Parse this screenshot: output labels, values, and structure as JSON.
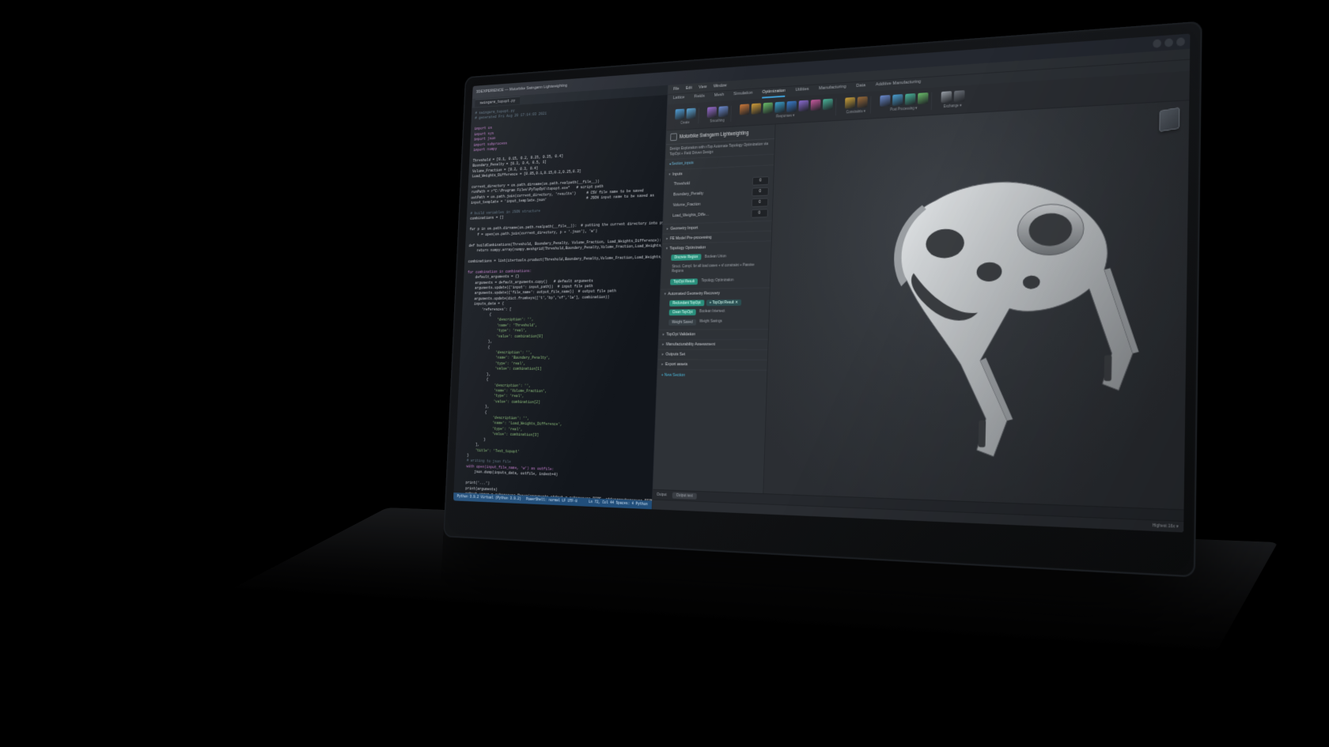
{
  "window_title": "3DEXPERIENCE — Motorbike Swingarm Lightweighting",
  "editor": {
    "tab": "swingarm_topopt.py",
    "status": {
      "left": "Python 3.9.2   Virtual (Python 3.9.2)",
      "mid": "PowerShell: normal  LF  UTF-8",
      "right": "Ln 72, Col 44   Spaces: 4   Python"
    },
    "code_lines": [
      {
        "cls": "cm",
        "t": "# swingarm_topopt.py"
      },
      {
        "cls": "cm",
        "t": "# generated Fri Aug 20 17:14:03 2021"
      },
      {
        "cls": "",
        "t": ""
      },
      {
        "cls": "kw",
        "t": "import os"
      },
      {
        "cls": "kw",
        "t": "import sys"
      },
      {
        "cls": "kw",
        "t": "import json"
      },
      {
        "cls": "kw",
        "t": "import subprocess"
      },
      {
        "cls": "kw",
        "t": "import numpy"
      },
      {
        "cls": "",
        "t": ""
      },
      {
        "cls": "nm",
        "t": "Threshold = [0.1, 0.15, 0.2, 0.25, 0.35, 0.4]"
      },
      {
        "cls": "nm",
        "t": "Boundary_Penalty = [0.3, 0.4, 0.5, 1]"
      },
      {
        "cls": "nm",
        "t": "Volume_Fraction = [0.2, 0.3, 0.4]"
      },
      {
        "cls": "nm",
        "t": "Load_Weights_Difference = [0.05,0.1,0.15,0.2,0.25,0.3]"
      },
      {
        "cls": "",
        "t": ""
      },
      {
        "cls": "nm",
        "t": "current_directory = os.path.dirname(os.path.realpath(__file__))"
      },
      {
        "cls": "nm",
        "t": "runPath = r\"C:\\Program Files\\PyTopOpt\\topopt.exe\"   # script path"
      },
      {
        "cls": "nm",
        "t": "outPath = os.path.join(current_directory, 'results')     # CSV file name to be saved"
      },
      {
        "cls": "nm",
        "t": "input_template = 'input_template.json'                   # JSON input name to be saved as"
      },
      {
        "cls": "",
        "t": ""
      },
      {
        "cls": "cm",
        "t": "# build variables in JSON structure"
      },
      {
        "cls": "nm",
        "t": "combinations = []"
      },
      {
        "cls": "",
        "t": ""
      },
      {
        "cls": "nm",
        "t": "for p in os.path.dirname(os.path.realpath(__file__)):  # putting the current directory into python file so"
      },
      {
        "cls": "nm",
        "t": "    f = open(os.path.join(current_directory, p + '.json'), 'w')"
      },
      {
        "cls": "",
        "t": ""
      },
      {
        "cls": "nm",
        "t": "def buildCombinations(Threshold, Boundary_Penalty, Volume_Fraction, Load_Weights_Difference):"
      },
      {
        "cls": "nm",
        "t": "    return numpy.array(numpy.meshgrid(Threshold,Boundary_Penalty,Volume_Fraction,Load_Weights_Difference))"
      },
      {
        "cls": "",
        "t": ""
      },
      {
        "cls": "nm",
        "t": "combinations = list(itertools.product(Threshold,Boundary_Penalty,Volume_Fraction,Load_Weights_Difference))"
      },
      {
        "cls": "",
        "t": ""
      },
      {
        "cls": "kw",
        "t": "for combination in combinations:"
      },
      {
        "cls": "nm",
        "t": "    default_arguments = {}"
      },
      {
        "cls": "nm",
        "t": "    arguments = default_arguments.copy()   # default arguments"
      },
      {
        "cls": "nm",
        "t": "    arguments.update({'input': input_path})  # input file path"
      },
      {
        "cls": "nm",
        "t": "    arguments.update({'file_name': output_file_name})  # output file path"
      },
      {
        "cls": "nm",
        "t": "    arguments.update(dict.fromkeys(['t','bp','vf','lw'], combination))"
      },
      {
        "cls": "nm",
        "t": "    inputs_data = {"
      },
      {
        "cls": "nm",
        "t": "        'references': ["
      },
      {
        "cls": "nm",
        "t": "            {"
      },
      {
        "cls": "st",
        "t": "                'description': '',"
      },
      {
        "cls": "st",
        "t": "                'name': 'Threshold',"
      },
      {
        "cls": "st",
        "t": "                'type': 'real',"
      },
      {
        "cls": "st",
        "t": "                'value': combination[0]"
      },
      {
        "cls": "nm",
        "t": "            },"
      },
      {
        "cls": "nm",
        "t": "            {"
      },
      {
        "cls": "st",
        "t": "                'description': '',"
      },
      {
        "cls": "st",
        "t": "                'name': 'Boundary_Penalty',"
      },
      {
        "cls": "st",
        "t": "                'type': 'real',"
      },
      {
        "cls": "st",
        "t": "                'value': combination[1]"
      },
      {
        "cls": "nm",
        "t": "            },"
      },
      {
        "cls": "nm",
        "t": "            {"
      },
      {
        "cls": "st",
        "t": "                'description': '',"
      },
      {
        "cls": "st",
        "t": "                'name': 'Volume_Fraction',"
      },
      {
        "cls": "st",
        "t": "                'type': 'real',"
      },
      {
        "cls": "st",
        "t": "                'value': combination[2]"
      },
      {
        "cls": "nm",
        "t": "            },"
      },
      {
        "cls": "nm",
        "t": "            {"
      },
      {
        "cls": "st",
        "t": "                'description': '',"
      },
      {
        "cls": "st",
        "t": "                'name': 'Load_Weights_Difference',"
      },
      {
        "cls": "st",
        "t": "                'type': 'real',"
      },
      {
        "cls": "st",
        "t": "                'value': combination[3]"
      },
      {
        "cls": "nm",
        "t": "            }"
      },
      {
        "cls": "nm",
        "t": "        ],"
      },
      {
        "cls": "st",
        "t": "        'title': 'Test_topopt'"
      },
      {
        "cls": "nm",
        "t": "    }"
      },
      {
        "cls": "cm",
        "t": "    # writing to json file"
      },
      {
        "cls": "kw",
        "t": "    with open(input_file_name, 'w') as outfile:"
      },
      {
        "cls": "nm",
        "t": "        json.dump(inputs_data, outfile, indent=4)"
      },
      {
        "cls": "",
        "t": ""
      },
      {
        "cls": "nm",
        "t": "    print('...')"
      },
      {
        "cls": "nm",
        "t": "    print(arguments)"
      },
      {
        "cls": "nm",
        "t": "    output,error = subprocess.Popen(arguments,stdout = subprocess.PIPE, stderr=subprocess.PIPE).communicate()"
      }
    ]
  },
  "app": {
    "menu": [
      "File",
      "Edit",
      "View",
      "Window"
    ],
    "ribbon_tabs": [
      "Lattice",
      "Fields",
      "Mesh",
      "Simulation",
      "Optimization",
      "Utilities",
      "Manufacturing",
      "Data",
      "Additive Manufacturing"
    ],
    "ribbon_active": "Optimization",
    "ribbon_groups": [
      {
        "label": "Create",
        "colors": [
          "#4c9ed9",
          "#5aa6d8"
        ]
      },
      {
        "label": "Smoothing",
        "colors": [
          "#9a6bd1",
          "#6b8bd1"
        ]
      },
      {
        "label": "Responses ▾",
        "colors": [
          "#ce7a3a",
          "#d4a03a",
          "#6bbf6b",
          "#3aa0ce",
          "#3a7dce",
          "#8b6bd1",
          "#c95aa0",
          "#4ab59a"
        ]
      },
      {
        "label": "Constraints ▾",
        "colors": [
          "#cda23a",
          "#9a6b3a"
        ]
      },
      {
        "label": "Post Processing ▾",
        "colors": [
          "#6b8bd1",
          "#4a9ed1",
          "#4ab59a",
          "#6bbf6b"
        ]
      },
      {
        "label": "Exchange ▾",
        "colors": [
          "#9aa0a8",
          "#6b7078"
        ]
      }
    ],
    "panel": {
      "title": "Motorbike Swingarm Lightweighting",
      "subtitle": "Design Exploration with nTop Automate\nTopology Optimization via TopOpt + Field Driven Design",
      "breadcrumb": "◂ Section_inputs",
      "inputs": {
        "header": "Inputs",
        "fields": [
          {
            "label": "Threshold",
            "value": "0"
          },
          {
            "label": "Boundary_Penalty",
            "value": "0"
          },
          {
            "label": "Volume_Fraction",
            "value": "0"
          },
          {
            "label": "Load_Weights_Diffe…",
            "value": "0"
          }
        ]
      },
      "sections_collapsed": [
        "Geometry Import",
        "FE Model Pre-processing"
      ],
      "topo": {
        "header": "Topology Optimization",
        "row1": {
          "chip": "Discrete Region",
          "label": "Boolean Union"
        },
        "note": "Struct. Compl. for all load cases + vf constraint + Passive Regions",
        "row2": {
          "chip": "TopOpt Result",
          "label": "Topology Optimization"
        }
      },
      "geom": {
        "header": "Automated Geometry Recovery",
        "row1": {
          "chip1": "Redundant TopOpt",
          "chip2": "+ TopOpt Result  ✕"
        },
        "row2": {
          "chip": "Clean TopOpt",
          "label": "Boolean Intersect"
        },
        "row3": {
          "chip": "Weight Saved",
          "label": "Weight Savings"
        }
      },
      "tail": [
        "TopOpt Validation",
        "Manufacturability Assessment",
        "Outputs Set",
        "Export assets"
      ],
      "new": "+  New Section"
    },
    "output_tabs": [
      "Output",
      "Output text"
    ],
    "status_right": "Highest  16x ▾"
  }
}
